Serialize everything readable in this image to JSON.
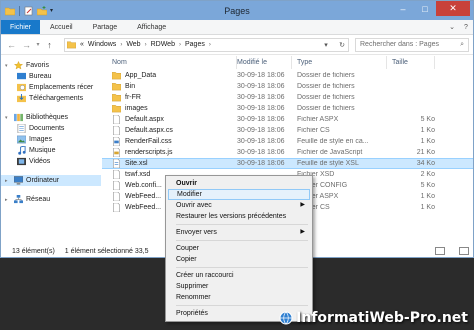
{
  "window": {
    "title": "Pages"
  },
  "ribbon": {
    "tabs": [
      "Fichier",
      "Accueil",
      "Partage",
      "Affichage"
    ]
  },
  "address": {
    "crumbs": [
      "«",
      "Windows",
      "Web",
      "RDWeb",
      "Pages"
    ],
    "search_placeholder": "Rechercher dans : Pages"
  },
  "nav": {
    "favorites": {
      "label": "Favoris",
      "items": [
        "Bureau",
        "Emplacements récer",
        "Téléchargements"
      ]
    },
    "libraries": {
      "label": "Bibliothèques",
      "items": [
        "Documents",
        "Images",
        "Musique",
        "Vidéos"
      ]
    },
    "computer": "Ordinateur",
    "network": "Réseau"
  },
  "columns": {
    "name": "Nom",
    "date": "Modifié le",
    "type": "Type",
    "size": "Taille"
  },
  "files": [
    {
      "name": "App_Data",
      "date": "30-09-18 18:06",
      "type": "Dossier de fichiers",
      "size": "",
      "icon": "folder-icon"
    },
    {
      "name": "Bin",
      "date": "30-09-18 18:06",
      "type": "Dossier de fichiers",
      "size": "",
      "icon": "folder-icon"
    },
    {
      "name": "fr-FR",
      "date": "30-09-18 18:06",
      "type": "Dossier de fichiers",
      "size": "",
      "icon": "folder-icon"
    },
    {
      "name": "images",
      "date": "30-09-18 18:06",
      "type": "Dossier de fichiers",
      "size": "",
      "icon": "folder-icon"
    },
    {
      "name": "Default.aspx",
      "date": "30-09-18 18:06",
      "type": "Fichier ASPX",
      "size": "5 Ko",
      "icon": "file-icon"
    },
    {
      "name": "Default.aspx.cs",
      "date": "30-09-18 18:06",
      "type": "Fichier CS",
      "size": "1 Ko",
      "icon": "file-icon"
    },
    {
      "name": "RenderFail.css",
      "date": "30-09-18 18:06",
      "type": "Feuille de style en ca...",
      "size": "1 Ko",
      "icon": "css-file-icon"
    },
    {
      "name": "renderscripts.js",
      "date": "30-09-18 18:06",
      "type": "Fichier de JavaScript",
      "size": "21 Ko",
      "icon": "js-file-icon"
    },
    {
      "name": "Site.xsl",
      "date": "30-09-18 18:06",
      "type": "Feuille de style XSL",
      "size": "34 Ko",
      "icon": "xsl-file-icon",
      "selected": true
    },
    {
      "name": "tswf.xsd",
      "date": "",
      "type": "Fichier XSD",
      "size": "2 Ko",
      "icon": "file-icon"
    },
    {
      "name": "Web.confi...",
      "date": "",
      "type": "Fichier CONFIG",
      "size": "5 Ko",
      "icon": "file-icon"
    },
    {
      "name": "WebFeed...",
      "date": "",
      "type": "Fichier ASPX",
      "size": "1 Ko",
      "icon": "file-icon"
    },
    {
      "name": "WebFeed...",
      "date": "",
      "type": "Fichier CS",
      "size": "1 Ko",
      "icon": "file-icon"
    }
  ],
  "status": {
    "count": "13 élément(s)",
    "selection": "1 élément sélectionné  33,5"
  },
  "context_menu": {
    "items": [
      {
        "label": "Ouvrir",
        "bold": true
      },
      {
        "label": "Modifier",
        "highlighted": true
      },
      {
        "label": "Ouvrir avec",
        "submenu": true
      },
      {
        "label": "Restaurer les versions précédentes"
      },
      {
        "sep": true
      },
      {
        "label": "Envoyer vers",
        "submenu": true
      },
      {
        "sep": true
      },
      {
        "label": "Couper"
      },
      {
        "label": "Copier"
      },
      {
        "sep": true
      },
      {
        "label": "Créer un raccourci"
      },
      {
        "label": "Supprimer"
      },
      {
        "label": "Renommer"
      },
      {
        "sep": true
      },
      {
        "label": "Propriétés"
      }
    ]
  },
  "watermark": "InformatiWeb-Pro.net",
  "colors": {
    "titlebar": "#7ba7d9",
    "file_tab": "#1979ca",
    "selection": "#cce8ff",
    "close": "#c8413a"
  }
}
